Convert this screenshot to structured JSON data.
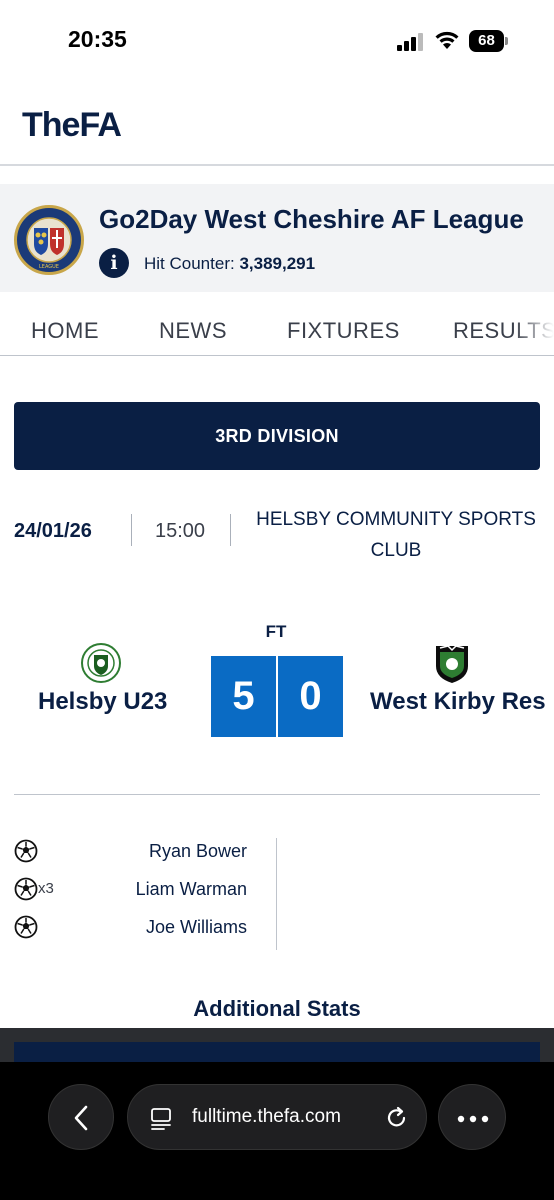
{
  "status_bar": {
    "time": "20:35",
    "battery": "68",
    "icons": [
      "signal-icon",
      "wifi-icon",
      "battery-icon"
    ]
  },
  "header": {
    "logo_text": "TheFA"
  },
  "league": {
    "title": "Go2Day West Cheshire AF League",
    "hit_counter_label": "Hit Counter:",
    "hit_counter_value": "3,389,291",
    "crest_text": "WEST CHESHIRE AF LEAGUE"
  },
  "nav": {
    "items": [
      "HOME",
      "NEWS",
      "FIXTURES",
      "RESULTS"
    ]
  },
  "match": {
    "division": "3RD DIVISION",
    "date": "24/01/26",
    "time": "15:00",
    "venue": "HELSBY COMMUNITY SPORTS CLUB",
    "status": "FT",
    "home_team": "Helsby U23",
    "away_team": "West Kirby Res",
    "home_score": "5",
    "away_score": "0"
  },
  "scorers": {
    "home": [
      {
        "name": "Ryan Bower",
        "count": ""
      },
      {
        "name": "Liam Warman",
        "count": "x3"
      },
      {
        "name": "Joe Williams",
        "count": ""
      }
    ]
  },
  "additional_stats_title": "Additional Stats",
  "browser": {
    "url": "fulltime.thefa.com"
  },
  "colors": {
    "navy": "#0a1f44",
    "score_blue": "#0a6bc4",
    "league_bg": "#f2f3f5"
  }
}
